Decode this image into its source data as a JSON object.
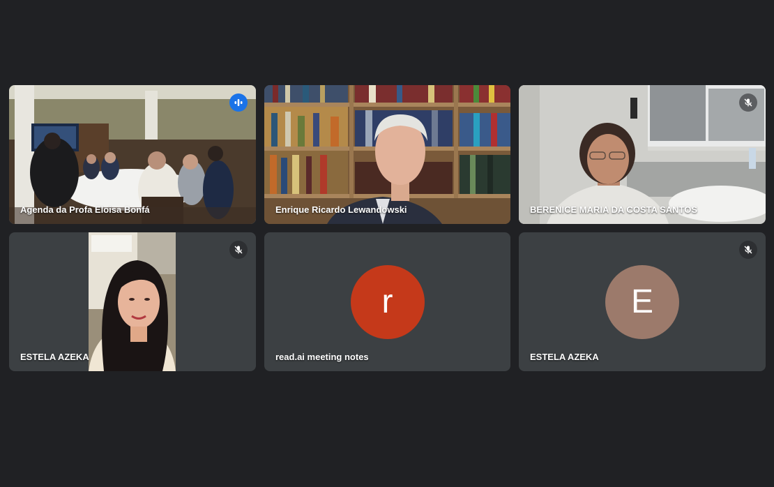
{
  "tiles": [
    {
      "name": "Agenda da Profa Eloisa Bonfá",
      "speaking": true,
      "muted": false
    },
    {
      "name": "Enrique Ricardo Lewandowski",
      "speaking": false,
      "muted": false
    },
    {
      "name": "BERENICE MARIA DA COSTA SANTOS",
      "speaking": false,
      "muted": true
    },
    {
      "name": "ESTELA AZEKA",
      "speaking": false,
      "muted": true
    },
    {
      "name": "read.ai meeting notes",
      "avatar_letter": "r",
      "avatar_color": "#c5391a",
      "muted": false
    },
    {
      "name": "ESTELA AZEKA",
      "avatar_letter": "E",
      "avatar_color": "#9c7a6b",
      "muted": true
    }
  ],
  "colors": {
    "background": "#202124",
    "tile": "#3c4043",
    "active_outline": "#8ab4f8",
    "speaking_badge": "#1a73e8"
  }
}
